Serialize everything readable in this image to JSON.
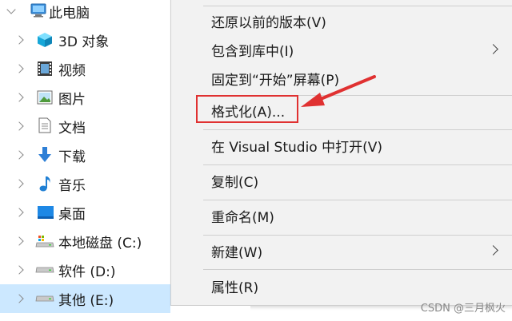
{
  "tree": {
    "items": [
      {
        "label": "此电脑",
        "icon": "pc-icon",
        "expanded": true
      },
      {
        "label": "3D 对象",
        "icon": "3d-objects-icon"
      },
      {
        "label": "视频",
        "icon": "video-icon"
      },
      {
        "label": "图片",
        "icon": "picture-icon"
      },
      {
        "label": "文档",
        "icon": "document-icon"
      },
      {
        "label": "下载",
        "icon": "download-icon"
      },
      {
        "label": "音乐",
        "icon": "music-icon"
      },
      {
        "label": "桌面",
        "icon": "desktop-icon"
      },
      {
        "label": "本地磁盘 (C:)",
        "icon": "system-drive-icon"
      },
      {
        "label": "软件 (D:)",
        "icon": "drive-icon"
      },
      {
        "label": "其他 (E:)",
        "icon": "drive-icon",
        "selected": true
      }
    ]
  },
  "menu": {
    "items": [
      {
        "label": "还原以前的版本(V)"
      },
      {
        "label": "包含到库中(I)",
        "submenu": true
      },
      {
        "label": "固定到“开始”屏幕(P)"
      },
      {
        "label": "格式化(A)...",
        "highlighted": true
      },
      {
        "label": "在 Visual Studio 中打开(V)"
      },
      {
        "label": "复制(C)"
      },
      {
        "label": "重命名(M)"
      },
      {
        "label": "新建(W)",
        "submenu": true
      },
      {
        "label": "属性(R)"
      }
    ]
  },
  "annotation_color": "#e03131",
  "selected_color": "#cce8ff",
  "watermark": "CSDN @三月枫火"
}
